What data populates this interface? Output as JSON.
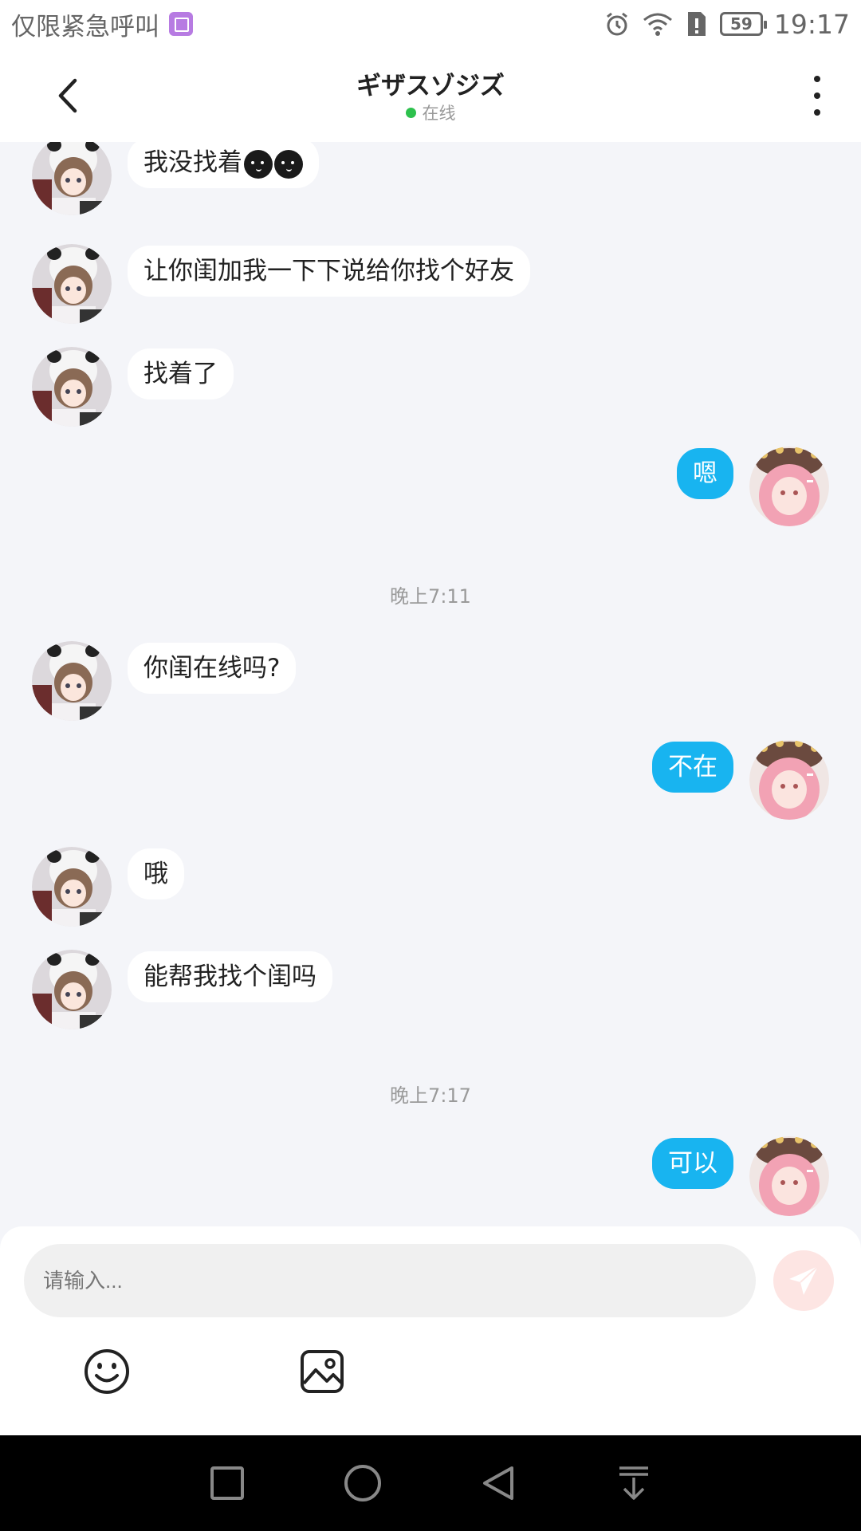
{
  "status_bar": {
    "carrier": "仅限紧急呼叫",
    "battery": "59",
    "time": "19:17"
  },
  "header": {
    "title": "ギザスゾジズ",
    "status": "在线",
    "status_color": "#2dc14d"
  },
  "messages": [
    {
      "dir": "in",
      "text": "我没找着",
      "emoji": [
        "dark-face-emoji",
        "dark-face-emoji"
      ]
    },
    {
      "dir": "in",
      "text": "让你闺加我一下下说给你找个好友"
    },
    {
      "dir": "in",
      "text": "找着了"
    },
    {
      "dir": "out",
      "text": "嗯"
    },
    {
      "time": "晚上7:11"
    },
    {
      "dir": "in",
      "text": "你闺在线吗?"
    },
    {
      "dir": "out",
      "text": "不在"
    },
    {
      "dir": "in",
      "text": "哦"
    },
    {
      "dir": "in",
      "text": "能帮我找个闺吗"
    },
    {
      "time": "晚上7:17"
    },
    {
      "dir": "out",
      "text": "可以"
    }
  ],
  "input": {
    "placeholder": "请输入..."
  },
  "icons": {
    "back": "chevron-left-icon",
    "more": "more-vertical-icon",
    "send": "paper-plane-icon",
    "emoji": "smiley-icon",
    "image": "image-icon"
  },
  "colors": {
    "outgoing_bubble": "#18b4f0",
    "incoming_bubble": "#ffffff",
    "background": "#f4f5f9",
    "send_button": "#fde5e3"
  }
}
